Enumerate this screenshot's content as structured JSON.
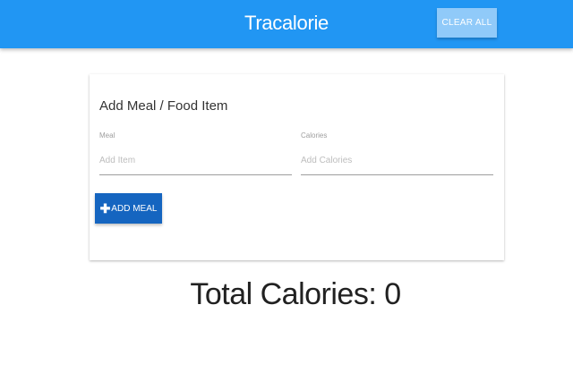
{
  "navbar": {
    "brand": "Tracalorie",
    "clear_all_label": "CLEAR ALL",
    "color": "#2196f3"
  },
  "form": {
    "title": "Add Meal / Food Item",
    "meal": {
      "label": "Meal",
      "placeholder": "Add Item",
      "value": ""
    },
    "calories": {
      "label": "Calories",
      "placeholder": "Add Calories",
      "value": ""
    },
    "add_button": {
      "icon": "plus-icon",
      "label": "ADD MEAL",
      "color": "#1565c0"
    }
  },
  "totals": {
    "label": "Total Calories:",
    "value": "0"
  }
}
